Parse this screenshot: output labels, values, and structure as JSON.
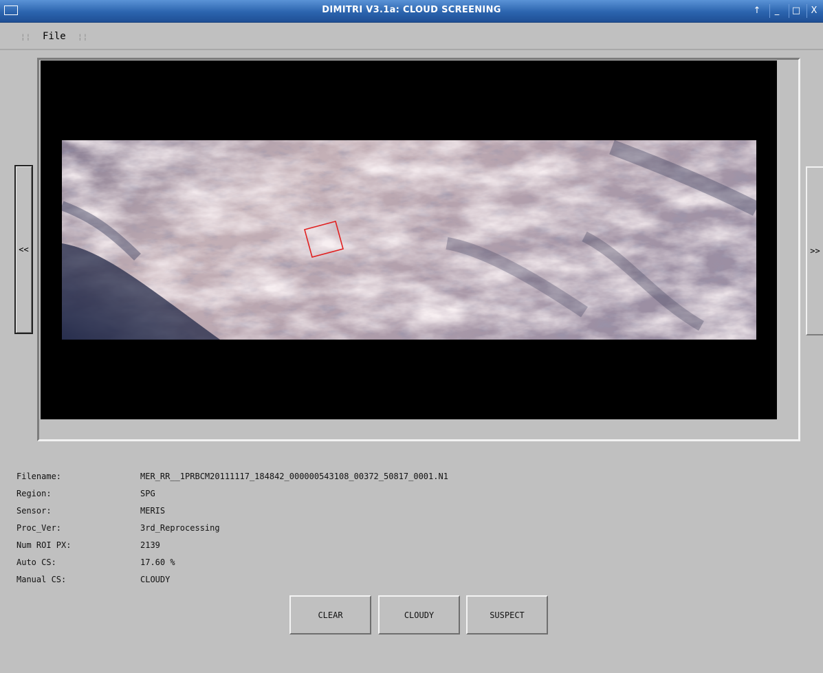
{
  "window": {
    "title": "DIMITRI V3.1a: CLOUD SCREENING",
    "controls": [
      "↑",
      "_",
      "□",
      "X"
    ]
  },
  "menu": {
    "items": [
      "File"
    ]
  },
  "nav": {
    "prev_label": "<<",
    "next_label": ">>"
  },
  "image": {
    "icon": "satellite-cloud-image",
    "roi_color": "#e02020"
  },
  "info": [
    {
      "label": "Filename:",
      "value": "MER_RR__1PRBCM20111117_184842_000000543108_00372_50817_0001.N1"
    },
    {
      "label": "Region:",
      "value": "SPG"
    },
    {
      "label": "Sensor:",
      "value": "MERIS"
    },
    {
      "label": "Proc_Ver:",
      "value": "3rd_Reprocessing"
    },
    {
      "label": "Num ROI PX:",
      "value": "2139"
    },
    {
      "label": "Auto CS:",
      "value": "17.60 %"
    },
    {
      "label": "Manual CS:",
      "value": "CLOUDY"
    }
  ],
  "buttons": {
    "clear": "CLEAR",
    "cloudy": "CLOUDY",
    "suspect": "SUSPECT"
  },
  "colors": {
    "titlebar": "#2b64ae",
    "background": "#c0c0c0",
    "canvas": "#000000"
  }
}
